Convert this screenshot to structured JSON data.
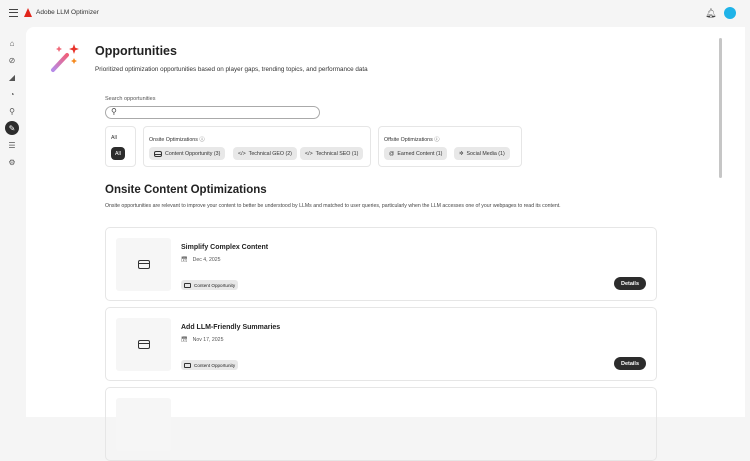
{
  "app": {
    "title": "Adobe LLM Optimizer"
  },
  "sidebar": {
    "items": [
      {
        "icon": "home-icon"
      },
      {
        "icon": "compass-icon"
      },
      {
        "icon": "chart-icon"
      },
      {
        "icon": "gauge-icon"
      },
      {
        "icon": "search-icon"
      },
      {
        "icon": "wand-icon",
        "active": true
      },
      {
        "icon": "database-icon"
      },
      {
        "icon": "gear-icon"
      }
    ]
  },
  "page": {
    "title": "Opportunities",
    "subtitle": "Prioritized optimization opportunities based on player gaps, trending topics, and performance data"
  },
  "search": {
    "label": "Search opportunities",
    "placeholder": ""
  },
  "filters": {
    "all": {
      "title": "All",
      "chip": "All"
    },
    "onsite": {
      "title": "Onsite Optimizations",
      "chips": [
        "Content Opportunity (3)",
        "Technical GEO (2)",
        "Technical SEO (1)"
      ]
    },
    "offsite": {
      "title": "Offsite Optimizations",
      "chips": [
        "Earned Content (1)",
        "Social Media (1)"
      ]
    }
  },
  "section": {
    "title": "Onsite Content Optimizations",
    "description": "Onsite opportunities are relevant to improve your content to better be understood by LLMs and matched to user queries, particularly when the LLM accesses one of your webpages to read its content."
  },
  "cards": [
    {
      "title": "Simplify Complex Content",
      "date": "Dec 4, 2025",
      "tag": "Content Opportunity",
      "button": "Details"
    },
    {
      "title": "Add LLM-Friendly Summaries",
      "date": "Nov 17, 2025",
      "tag": "Content Opportunity",
      "button": "Details"
    }
  ]
}
